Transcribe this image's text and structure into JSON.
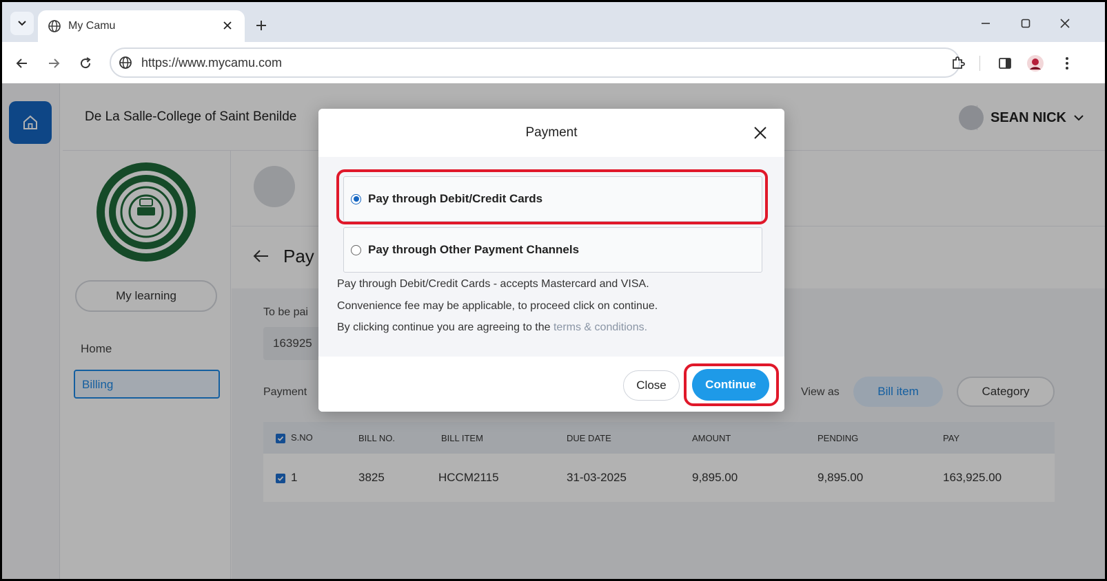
{
  "browser": {
    "tab_title": "My Camu",
    "url": "https://www.mycamu.com"
  },
  "app": {
    "college_name": "De La Salle-College of Saint Benilde",
    "user_name": "SEAN NICK",
    "nav": {
      "my_learning": "My learning",
      "home": "Home",
      "billing": "Billing"
    },
    "page_title_partial": "Pay",
    "to_be_paid_label": "To be pai",
    "amount_partial": "163925",
    "payment_label": "Payment",
    "view_as_label": "View as",
    "view_bill_item": "Bill item",
    "view_category": "Category",
    "table": {
      "headers": [
        "S.NO",
        "BILL NO.",
        "BILL ITEM",
        "DUE DATE",
        "AMOUNT",
        "PENDING",
        "PAY"
      ],
      "rows": [
        [
          "1",
          "3825",
          "HCCM2115",
          "31-03-2025",
          "9,895.00",
          "9,895.00",
          "163,925.00"
        ]
      ]
    }
  },
  "modal": {
    "title": "Payment",
    "option1": "Pay through Debit/Credit Cards",
    "option2": "Pay through Other Payment Channels",
    "selected": "option1",
    "info_line1": "Pay through Debit/Credit Cards - accepts Mastercard and VISA.",
    "info_line2": "Convenience fee may be applicable, to proceed click on continue.",
    "info_line3_prefix": "By clicking continue you are agreeing to the",
    "info_line3_link": "terms & conditions.",
    "close_label": "Close",
    "continue_label": "Continue"
  },
  "colors": {
    "accent": "#1e9ae8",
    "highlight": "#e0182a",
    "brand": "#1565c0"
  }
}
